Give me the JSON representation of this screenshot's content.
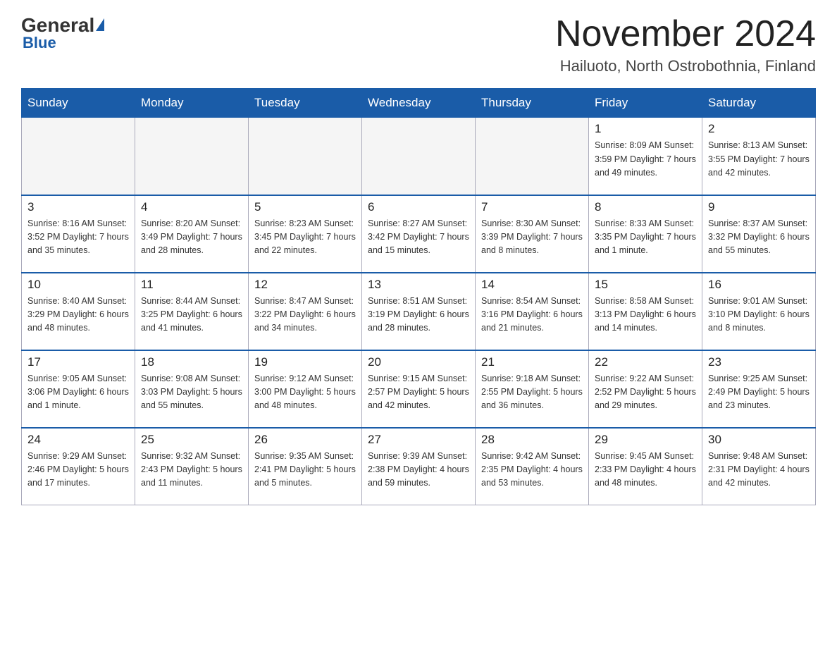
{
  "header": {
    "logo_general": "General",
    "logo_blue": "Blue",
    "month_year": "November 2024",
    "location": "Hailuoto, North Ostrobothnia, Finland"
  },
  "days_of_week": [
    "Sunday",
    "Monday",
    "Tuesday",
    "Wednesday",
    "Thursday",
    "Friday",
    "Saturday"
  ],
  "weeks": [
    [
      {
        "day": "",
        "info": ""
      },
      {
        "day": "",
        "info": ""
      },
      {
        "day": "",
        "info": ""
      },
      {
        "day": "",
        "info": ""
      },
      {
        "day": "",
        "info": ""
      },
      {
        "day": "1",
        "info": "Sunrise: 8:09 AM\nSunset: 3:59 PM\nDaylight: 7 hours\nand 49 minutes."
      },
      {
        "day": "2",
        "info": "Sunrise: 8:13 AM\nSunset: 3:55 PM\nDaylight: 7 hours\nand 42 minutes."
      }
    ],
    [
      {
        "day": "3",
        "info": "Sunrise: 8:16 AM\nSunset: 3:52 PM\nDaylight: 7 hours\nand 35 minutes."
      },
      {
        "day": "4",
        "info": "Sunrise: 8:20 AM\nSunset: 3:49 PM\nDaylight: 7 hours\nand 28 minutes."
      },
      {
        "day": "5",
        "info": "Sunrise: 8:23 AM\nSunset: 3:45 PM\nDaylight: 7 hours\nand 22 minutes."
      },
      {
        "day": "6",
        "info": "Sunrise: 8:27 AM\nSunset: 3:42 PM\nDaylight: 7 hours\nand 15 minutes."
      },
      {
        "day": "7",
        "info": "Sunrise: 8:30 AM\nSunset: 3:39 PM\nDaylight: 7 hours\nand 8 minutes."
      },
      {
        "day": "8",
        "info": "Sunrise: 8:33 AM\nSunset: 3:35 PM\nDaylight: 7 hours\nand 1 minute."
      },
      {
        "day": "9",
        "info": "Sunrise: 8:37 AM\nSunset: 3:32 PM\nDaylight: 6 hours\nand 55 minutes."
      }
    ],
    [
      {
        "day": "10",
        "info": "Sunrise: 8:40 AM\nSunset: 3:29 PM\nDaylight: 6 hours\nand 48 minutes."
      },
      {
        "day": "11",
        "info": "Sunrise: 8:44 AM\nSunset: 3:25 PM\nDaylight: 6 hours\nand 41 minutes."
      },
      {
        "day": "12",
        "info": "Sunrise: 8:47 AM\nSunset: 3:22 PM\nDaylight: 6 hours\nand 34 minutes."
      },
      {
        "day": "13",
        "info": "Sunrise: 8:51 AM\nSunset: 3:19 PM\nDaylight: 6 hours\nand 28 minutes."
      },
      {
        "day": "14",
        "info": "Sunrise: 8:54 AM\nSunset: 3:16 PM\nDaylight: 6 hours\nand 21 minutes."
      },
      {
        "day": "15",
        "info": "Sunrise: 8:58 AM\nSunset: 3:13 PM\nDaylight: 6 hours\nand 14 minutes."
      },
      {
        "day": "16",
        "info": "Sunrise: 9:01 AM\nSunset: 3:10 PM\nDaylight: 6 hours\nand 8 minutes."
      }
    ],
    [
      {
        "day": "17",
        "info": "Sunrise: 9:05 AM\nSunset: 3:06 PM\nDaylight: 6 hours\nand 1 minute."
      },
      {
        "day": "18",
        "info": "Sunrise: 9:08 AM\nSunset: 3:03 PM\nDaylight: 5 hours\nand 55 minutes."
      },
      {
        "day": "19",
        "info": "Sunrise: 9:12 AM\nSunset: 3:00 PM\nDaylight: 5 hours\nand 48 minutes."
      },
      {
        "day": "20",
        "info": "Sunrise: 9:15 AM\nSunset: 2:57 PM\nDaylight: 5 hours\nand 42 minutes."
      },
      {
        "day": "21",
        "info": "Sunrise: 9:18 AM\nSunset: 2:55 PM\nDaylight: 5 hours\nand 36 minutes."
      },
      {
        "day": "22",
        "info": "Sunrise: 9:22 AM\nSunset: 2:52 PM\nDaylight: 5 hours\nand 29 minutes."
      },
      {
        "day": "23",
        "info": "Sunrise: 9:25 AM\nSunset: 2:49 PM\nDaylight: 5 hours\nand 23 minutes."
      }
    ],
    [
      {
        "day": "24",
        "info": "Sunrise: 9:29 AM\nSunset: 2:46 PM\nDaylight: 5 hours\nand 17 minutes."
      },
      {
        "day": "25",
        "info": "Sunrise: 9:32 AM\nSunset: 2:43 PM\nDaylight: 5 hours\nand 11 minutes."
      },
      {
        "day": "26",
        "info": "Sunrise: 9:35 AM\nSunset: 2:41 PM\nDaylight: 5 hours\nand 5 minutes."
      },
      {
        "day": "27",
        "info": "Sunrise: 9:39 AM\nSunset: 2:38 PM\nDaylight: 4 hours\nand 59 minutes."
      },
      {
        "day": "28",
        "info": "Sunrise: 9:42 AM\nSunset: 2:35 PM\nDaylight: 4 hours\nand 53 minutes."
      },
      {
        "day": "29",
        "info": "Sunrise: 9:45 AM\nSunset: 2:33 PM\nDaylight: 4 hours\nand 48 minutes."
      },
      {
        "day": "30",
        "info": "Sunrise: 9:48 AM\nSunset: 2:31 PM\nDaylight: 4 hours\nand 42 minutes."
      }
    ]
  ]
}
